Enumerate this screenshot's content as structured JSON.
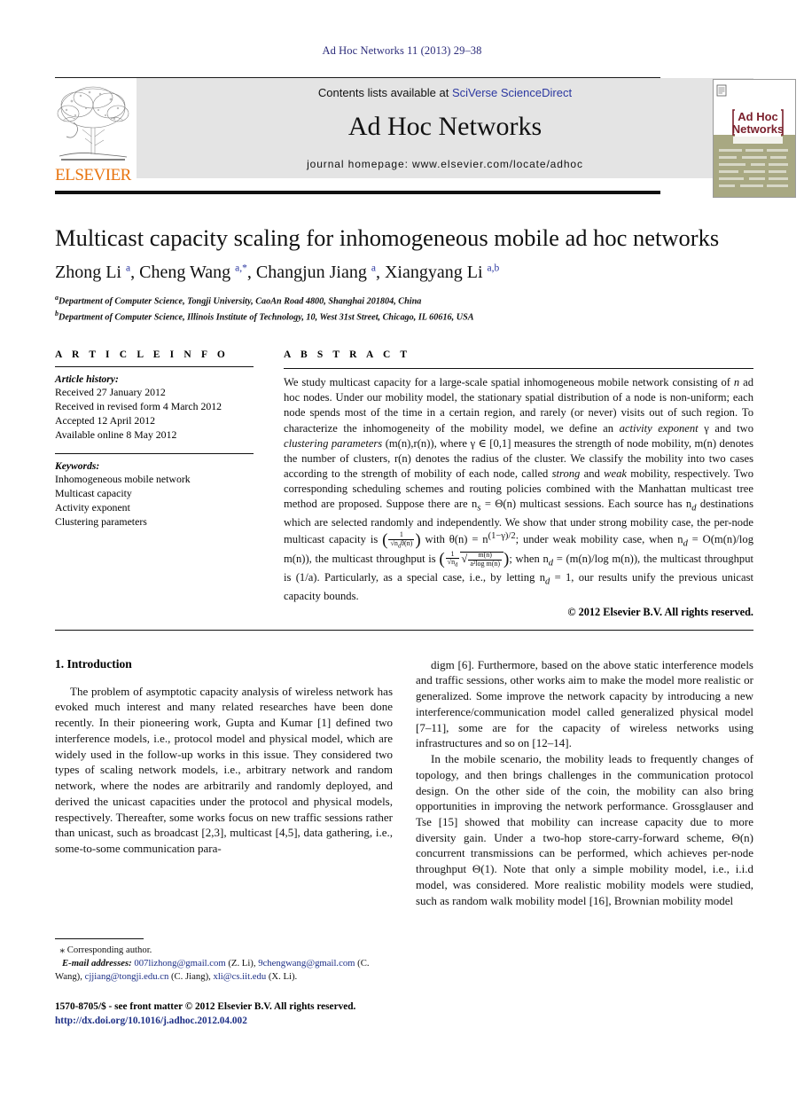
{
  "running_head": "Ad Hoc Networks 11 (2013) 29–38",
  "masthead": {
    "contents_prefix": "Contents lists available at ",
    "sciencedirect": "SciVerse ScienceDirect",
    "journal_name": "Ad Hoc Networks",
    "homepage": "journal homepage: www.elsevier.com/locate/adhoc",
    "publisher_wordmark": "ELSEVIER",
    "cover_title_line1": "Ad Hoc",
    "cover_title_line2": "Networks"
  },
  "title": "Multicast capacity scaling for inhomogeneous mobile ad hoc networks",
  "authors_html": "Zhong Li <sup>a</sup>, Cheng Wang <sup>a,*</sup>, Changjun Jiang <sup>a</sup>, Xiangyang Li <sup>a,b</sup>",
  "affiliations": [
    {
      "marker": "a",
      "text": "Department of Computer Science, Tongji University, CaoAn Road 4800, Shanghai 201804, China"
    },
    {
      "marker": "b",
      "text": "Department of Computer Science, Illinois Institute of Technology, 10, West 31st Street, Chicago, IL 60616, USA"
    }
  ],
  "article_info": {
    "heading": "A R T I C L E   I N F O",
    "history_label": "Article history:",
    "history": [
      "Received 27 January 2012",
      "Received in revised form 4 March 2012",
      "Accepted 12 April 2012",
      "Available online 8 May 2012"
    ],
    "keywords_label": "Keywords:",
    "keywords": [
      "Inhomogeneous mobile network",
      "Multicast capacity",
      "Activity exponent",
      "Clustering parameters"
    ]
  },
  "abstract": {
    "heading": "A B S T R A C T",
    "part1": "We study multicast capacity for a large-scale spatial inhomogeneous mobile network consisting of ",
    "part1_n": "n",
    "part2": " ad hoc nodes. Under our mobility model, the stationary spatial distribution of a node is non-uniform; each node spends most of the time in a certain region, and rarely (or never) visits out of such region. To characterize the inhomogeneity of the mobility model, we define an ",
    "em1": "activity exponent",
    "part3": " γ and two ",
    "em2": "clustering parameters",
    "part4": " (m(n),r(n)), where γ ∈ [0,1] measures the strength of node mobility, m(n) denotes the number of clusters, r(n) denotes the radius of the cluster. We classify the mobility into two cases according to the strength of mobility of each node, called ",
    "em3": "strong",
    "part5": " and ",
    "em4": "weak",
    "part6": " mobility, respectively. Two corresponding scheduling schemes and routing policies combined with the Manhattan multicast tree method are proposed. Suppose there are n",
    "sub_s": "s",
    "part7": " = Θ(n) multicast sessions. Each source has n",
    "sub_d": "d",
    "part8": " destinations which are selected randomly and independently. We show that under strong mobility case, the per-node multicast capacity is ",
    "formula1": "(1/(√n_d·θ(n)))",
    "part9": " with θ(n) = n",
    "exp1": "(1−γ)/2",
    "part10": "; under weak mobility case, when n",
    "part11": " = O(m(n)/log m(n)), the multicast throughput is ",
    "formula2": "(1/(√n_d)·√(m(n)/(a²·log m(n))))",
    "part12": "; when n",
    "part13": " = (m(n)/log m(n)), the multicast throughput is (1/a). Particularly, as a special case, i.e., by letting n",
    "part14": " = 1, our results unify the previous unicast capacity bounds.",
    "copyright": "© 2012 Elsevier B.V. All rights reserved."
  },
  "body": {
    "section_heading": "1. Introduction",
    "left_paragraphs": [
      "The problem of asymptotic capacity analysis of wireless network has evoked much interest and many related researches have been done recently. In their pioneering work, Gupta and Kumar [1] defined two interference models, i.e., protocol model and physical model, which are widely used in the follow-up works in this issue. They considered two types of scaling network models, i.e., arbitrary network and random network, where the nodes are arbitrarily and randomly deployed, and derived the unicast capacities under the protocol and physical models, respectively. Thereafter, some works focus on new traffic sessions rather than unicast, such as broadcast [2,3], multicast [4,5], data gathering, i.e., some-to-some communication para-"
    ],
    "right_paragraphs": [
      "digm [6]. Furthermore, based on the above static interference models and traffic sessions, other works aim to make the model more realistic or generalized. Some improve the network capacity by introducing a new interference/communication model called generalized physical model [7–11], some are for the capacity of wireless networks using infrastructures and so on [12–14].",
      "In the mobile scenario, the mobility leads to frequently changes of topology, and then brings challenges in the communication protocol design. On the other side of the coin, the mobility can also bring opportunities in improving the network performance. Grossglauser and Tse [15] showed that mobility can increase capacity due to more diversity gain. Under a two-hop store-carry-forward scheme, Θ(n) concurrent transmissions can be performed, which achieves per-node throughput Θ(1). Note that only a simple mobility model, i.e., i.i.d model, was considered. More realistic mobility models were studied, such as random walk mobility model [16], Brownian mobility model"
    ]
  },
  "footnote": {
    "corresponding": "Corresponding author.",
    "email_label": "E-mail addresses:",
    "emails_html": "<span class=\"mail\">007lizhong@gmail.com</span> (Z. Li), <span class=\"mail\">9chengwang@gmail.com</span> (C. Wang), <span class=\"mail\">cjjiang@tongji.edu.cn</span> (C. Jiang), <span class=\"mail\">xli@cs.iit.edu</span> (X. Li)."
  },
  "imprint": {
    "line1": "1570-8705/$ - see front matter © 2012 Elsevier B.V. All rights reserved.",
    "doi": "http://dx.doi.org/10.1016/j.adhoc.2012.04.002"
  },
  "colors": {
    "link": "#1d2f86",
    "running_head": "#2b2b7a",
    "elsevier_orange": "#e87511",
    "masthead_bg": "#e4e4e4",
    "cover_olive": "#a8a882"
  }
}
